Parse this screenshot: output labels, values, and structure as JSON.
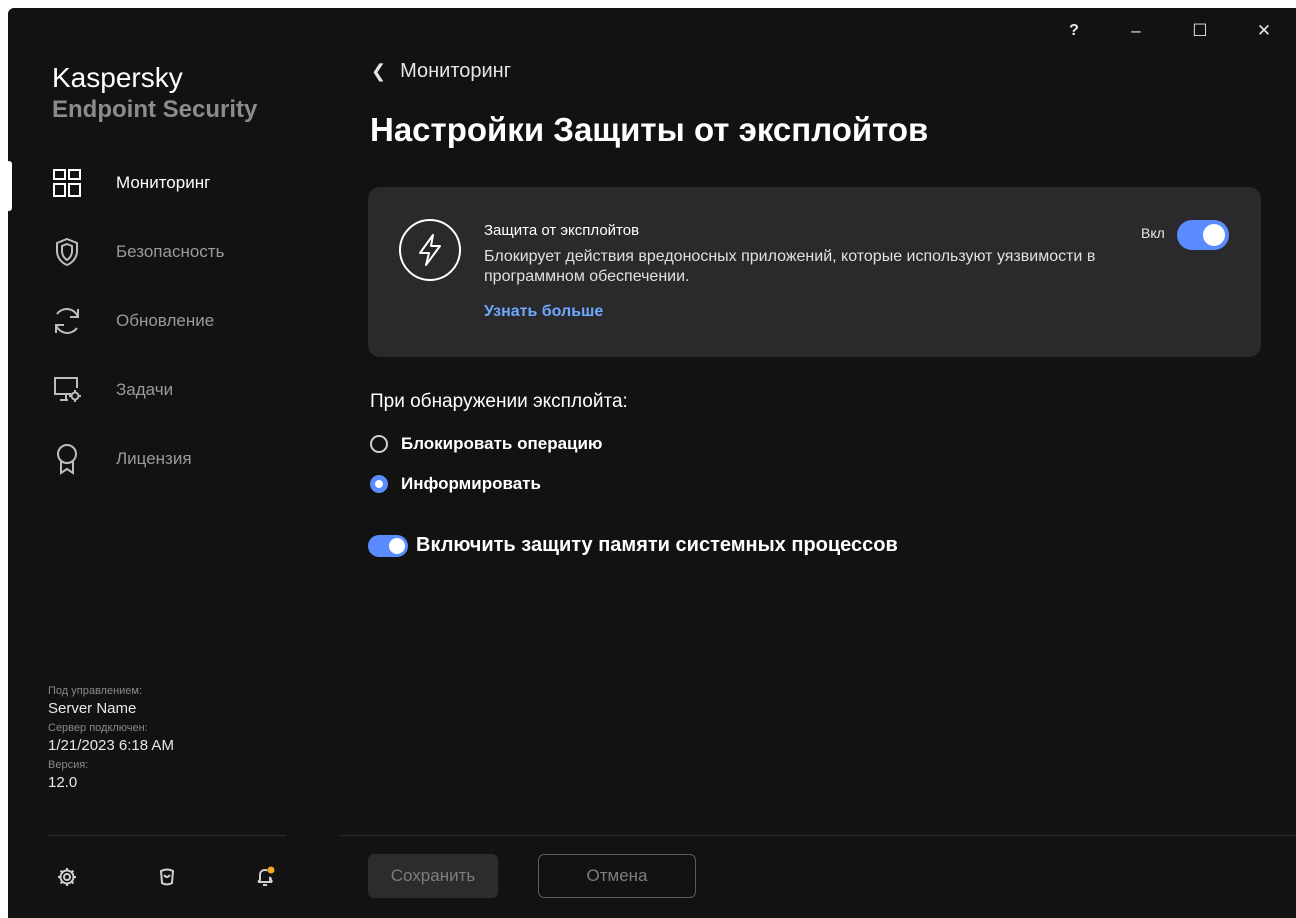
{
  "window": {
    "help_label": "?",
    "minimize_label": "–",
    "maximize_label": "☐",
    "close_label": "✕"
  },
  "brand": {
    "name": "Kaspersky",
    "product": "Endpoint Security"
  },
  "sidebar": {
    "items": [
      {
        "label": "Мониторинг",
        "icon": "dashboard-icon",
        "active": true
      },
      {
        "label": "Безопасность",
        "icon": "shield-icon",
        "active": false
      },
      {
        "label": "Обновление",
        "icon": "refresh-icon",
        "active": false
      },
      {
        "label": "Задачи",
        "icon": "computer-task-icon",
        "active": false
      },
      {
        "label": "Лицензия",
        "icon": "license-award-icon",
        "active": false
      }
    ],
    "management": {
      "managed_by_label": "Под управлением:",
      "managed_by_value": "Server Name",
      "connected_label": "Сервер подключен:",
      "connected_value": "1/21/2023 6:18 AM",
      "version_label": "Версия:",
      "version_value": "12.0"
    },
    "bottom_icons": [
      "settings-icon",
      "support-icon",
      "notifications-icon"
    ]
  },
  "main": {
    "back_label": "Мониторинг",
    "title": "Настройки Защиты от эксплойтов",
    "card": {
      "title": "Защита от эксплойтов",
      "description": "Блокирует действия вредоносных приложений, которые используют уязвимости в программном обеспечении.",
      "link": "Узнать больше",
      "toggle_label": "Вкл",
      "toggle_on": true
    },
    "on_exploit_label": "При обнаружении эксплойта:",
    "options": [
      {
        "label": "Блокировать операцию",
        "selected": false
      },
      {
        "label": "Информировать",
        "selected": true
      }
    ],
    "memory_protection_label": "Включить защиту памяти системных процессов",
    "memory_protection_on": true,
    "save_label": "Сохранить",
    "cancel_label": "Отмена"
  },
  "colors": {
    "background": "#121212",
    "card": "#2a2a2c",
    "accent": "#5b8cff",
    "link": "#6ea8ff",
    "notification_dot": "#f5a623"
  }
}
